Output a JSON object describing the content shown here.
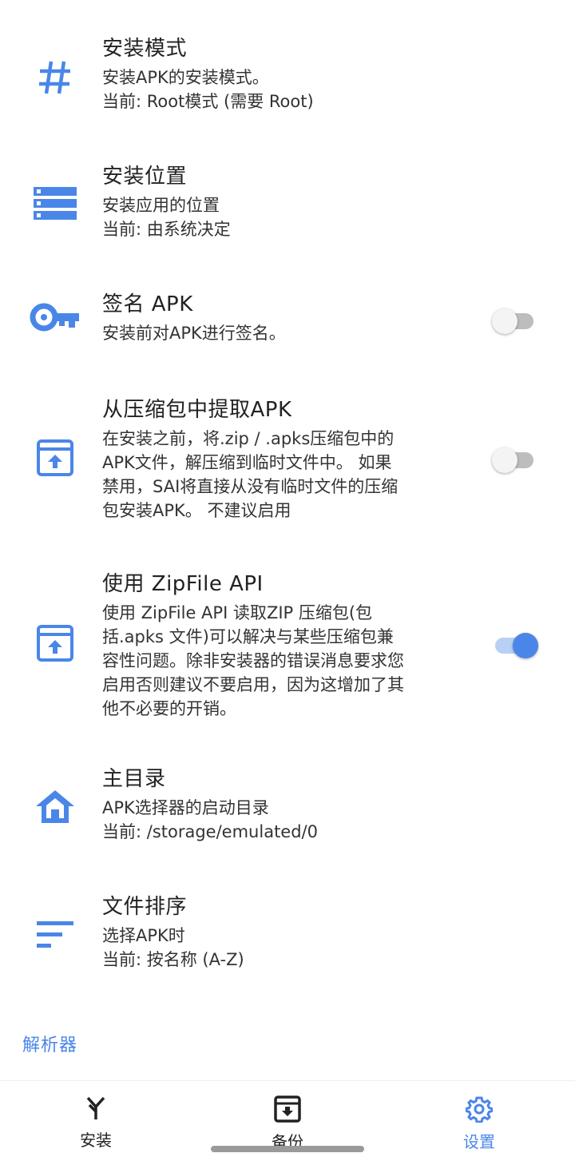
{
  "prefs": [
    {
      "title": "安装模式",
      "summary": "安装APK的安装模式。\n当前: Root模式 (需要 Root)",
      "icon": "hash-icon"
    },
    {
      "title": "安装位置",
      "summary": "安装应用的位置\n当前: 由系统决定",
      "icon": "storage-list-icon"
    },
    {
      "title": "签名 APK",
      "summary": "安装前对APK进行签名。",
      "icon": "key-icon",
      "switch": false
    },
    {
      "title": "从压缩包中提取APK",
      "summary": "在安装之前，将.zip / .apks压缩包中的\nAPK文件，解压缩到临时文件中。 如果\n禁用，SAI将直接从没有临时文件的压缩\n包安装APK。 不建议启用",
      "icon": "archive-upload-icon",
      "switch": false
    },
    {
      "title": "使用 ZipFile API",
      "summary": "使用 ZipFile API 读取ZIP 压缩包(包\n括.apks 文件)可以解决与某些压缩包兼\n容性问题。除非安装器的错误消息要求您\n启用否则建议不要启用，因为这增加了其\n他不必要的开销。",
      "icon": "archive-upload-icon",
      "switch": true
    },
    {
      "title": "主目录",
      "summary": "APK选择器的启动目录\n当前: /storage/emulated/0",
      "icon": "home-icon"
    },
    {
      "title": "文件排序",
      "summary": "选择APK时\n当前: 按名称 (A-Z)",
      "icon": "sort-icon"
    }
  ],
  "category_label": "解析器",
  "bottom_nav": [
    {
      "label": "安装",
      "icon": "install-icon"
    },
    {
      "label": "备份",
      "icon": "backup-icon"
    },
    {
      "label": "设置",
      "icon": "gear-icon"
    }
  ],
  "accent": "#4a86e8"
}
